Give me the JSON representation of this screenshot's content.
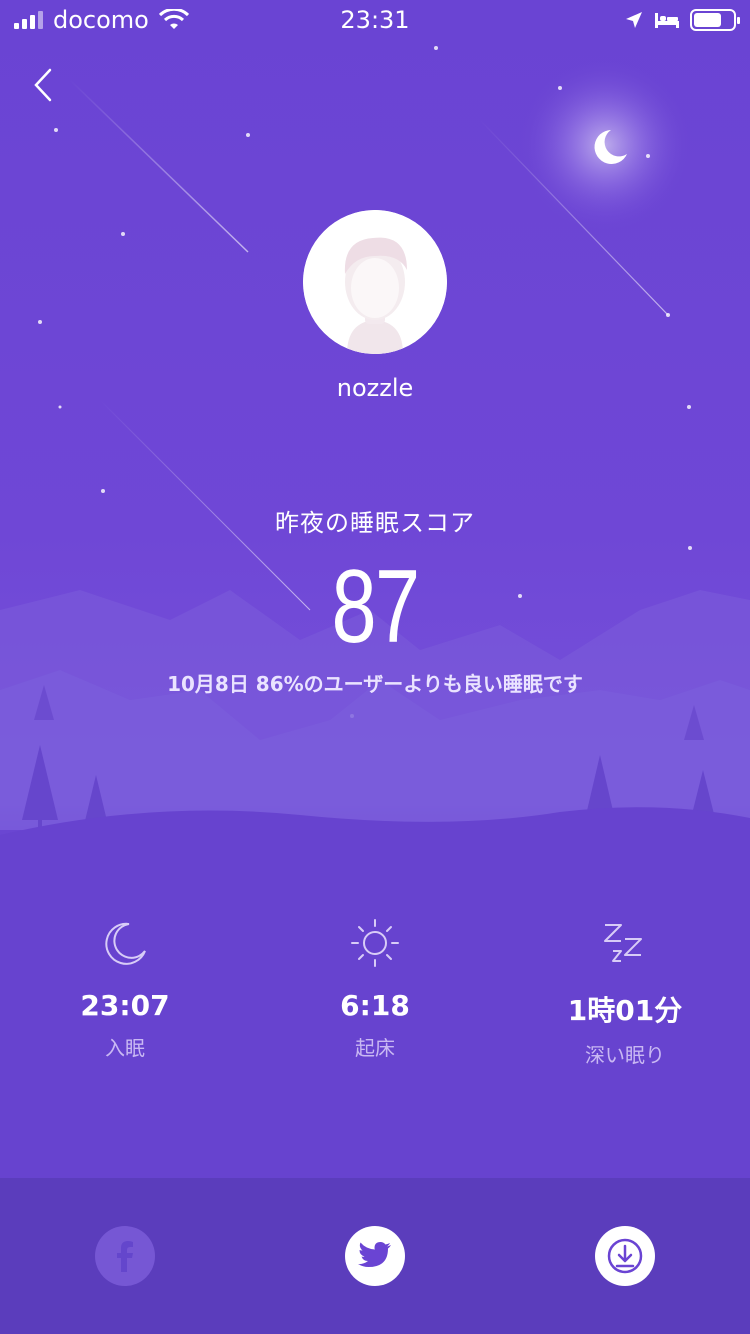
{
  "status_bar": {
    "carrier": "docomo",
    "time": "23:31"
  },
  "profile": {
    "username": "nozzle"
  },
  "score": {
    "title": "昨夜の睡眠スコア",
    "value": "87",
    "description": "10月8日 86%のユーザーよりも良い睡眠です"
  },
  "stats": [
    {
      "icon": "moon-icon",
      "value": "23:07",
      "label": "入眠"
    },
    {
      "icon": "sun-icon",
      "value": "6:18",
      "label": "起床"
    },
    {
      "icon": "zzz-icon",
      "value": "1時01分",
      "label": "深い眠り"
    }
  ],
  "share": {
    "buttons": [
      "facebook-icon",
      "twitter-icon",
      "download-icon"
    ]
  },
  "colors": {
    "background": "#6a44d3",
    "bottom_bar": "#5b3dbc",
    "accent": "#6a44d3"
  }
}
